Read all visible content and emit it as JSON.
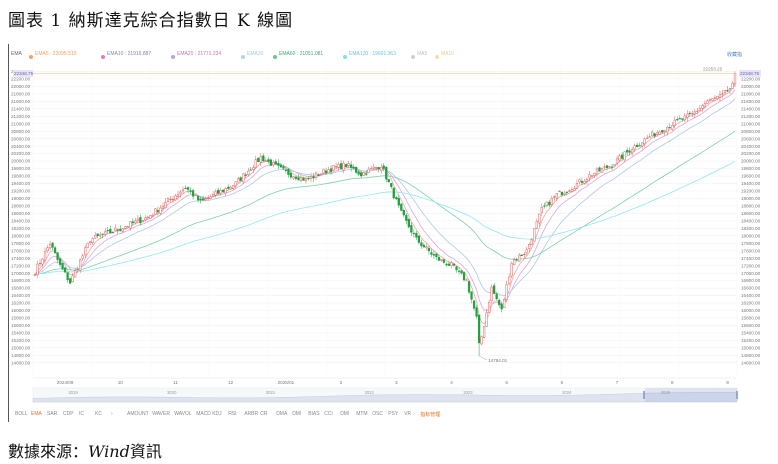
{
  "figure_title": "圖表 1 納斯達克綜合指數日 K 線圖",
  "source_label": "數據來源：",
  "source_name": "Wind",
  "source_suffix": "資訊",
  "toolbar": {
    "type_label": "EMA",
    "legend": [
      {
        "label": "EMA5 : 22095.510",
        "color": "#f0a060"
      },
      {
        "label": "EMA10 : 21916.887",
        "color": "#e080b0"
      },
      {
        "label": "EMA20 : 21771.234",
        "color": "#c0a0e0"
      },
      {
        "label": "EMA30",
        "color": "#a8d8e8"
      },
      {
        "label": "EMA60 : 21051.081",
        "color": "#60c890"
      },
      {
        "label": "EMA120 : 19601.363",
        "color": "#80e0f0"
      },
      {
        "label": "MA5",
        "color": "#d0d0d0"
      },
      {
        "label": "MA10",
        "color": "#f0e0a0"
      }
    ],
    "right_link": "收藏指"
  },
  "indicators": [
    "BOLL",
    "EMA",
    "SAR",
    "CDP",
    "IC",
    "KC",
    "›",
    "AMOUNT",
    "WAVER",
    "WAVOL",
    "MACD",
    "KDJ",
    "RSI",
    "ARBR",
    "CR",
    "DMA",
    "DMI",
    "BIAS",
    "CCI",
    "DMI",
    "MTM",
    "OSC",
    "PSY",
    "VR",
    "指标管理"
  ],
  "chart_data": {
    "type": "candlestick",
    "title": "納斯達克綜合指數日 K 線圖",
    "ylim": [
      14300,
      22600
    ],
    "yticks": [
      14600,
      14800,
      15000,
      15200,
      15400,
      15600,
      15800,
      16000,
      16200,
      16400,
      16600,
      16800,
      17000,
      17200,
      17400,
      17600,
      17800,
      18000,
      18200,
      18400,
      18600,
      18800,
      19000,
      19200,
      19400,
      19600,
      19800,
      20000,
      20200,
      20400,
      20600,
      20800,
      21000,
      21200,
      21400,
      21600,
      21800,
      22000,
      22200,
      22400
    ],
    "ytick_labels": [
      "14600.00",
      "14800.00",
      "15000.00",
      "15200.00",
      "15400.00",
      "15600.00",
      "15800.00",
      "16000.00",
      "16200.00",
      "16400.00",
      "16600.00",
      "16800.00",
      "17000.00",
      "17200.00",
      "17400.00",
      "17600.00",
      "17800.00",
      "18000.00",
      "18200.00",
      "18400.00",
      "18600.00",
      "18800.00",
      "19000.00",
      "19200.00",
      "19400.00",
      "19600.00",
      "19800.00",
      "20000.00",
      "20200.00",
      "20400.00",
      "20600.00",
      "20800.00",
      "21000.00",
      "21200.00",
      "21400.00",
      "21600.00",
      "21800.00",
      "22000.00",
      "22200.00",
      "22400.00"
    ],
    "xlabels": [
      "2024/09",
      "10",
      "11",
      "12",
      "2025/01",
      "2",
      "3",
      "4",
      "5",
      "6",
      "7",
      "8",
      "9"
    ],
    "xlabel_pos": [
      12,
      34,
      56,
      78,
      100,
      122,
      144,
      166,
      188,
      210,
      232,
      254,
      276
    ],
    "n_days": 280,
    "keypoints": [
      [
        0,
        17050
      ],
      [
        6,
        17800
      ],
      [
        10,
        17200
      ],
      [
        14,
        16750
      ],
      [
        22,
        17900
      ],
      [
        34,
        18200
      ],
      [
        45,
        18500
      ],
      [
        60,
        19300
      ],
      [
        66,
        18900
      ],
      [
        80,
        19400
      ],
      [
        90,
        20100
      ],
      [
        100,
        19700
      ],
      [
        108,
        19500
      ],
      [
        118,
        19800
      ],
      [
        124,
        19900
      ],
      [
        130,
        19650
      ],
      [
        138,
        19900
      ],
      [
        146,
        18600
      ],
      [
        152,
        17900
      ],
      [
        160,
        17400
      ],
      [
        166,
        17200
      ],
      [
        172,
        16800
      ],
      [
        178,
        15300
      ],
      [
        182,
        16600
      ],
      [
        186,
        16000
      ],
      [
        190,
        17300
      ],
      [
        196,
        17600
      ],
      [
        202,
        18700
      ],
      [
        208,
        19100
      ],
      [
        214,
        19300
      ],
      [
        222,
        19650
      ],
      [
        230,
        19900
      ],
      [
        238,
        20350
      ],
      [
        246,
        20700
      ],
      [
        254,
        21000
      ],
      [
        262,
        21250
      ],
      [
        268,
        21600
      ],
      [
        274,
        21750
      ],
      [
        280,
        22150
      ]
    ],
    "last_price_label": "22253.25",
    "current_price_label": "22348.75",
    "current_price": 22348.75,
    "low_annotation": "14784.01",
    "low_price": 14784.01,
    "low_index": 177,
    "series": [
      {
        "name": "EMA5",
        "span": 5,
        "color": "#f4a6a6"
      },
      {
        "name": "EMA10",
        "span": 10,
        "color": "#d8a8d8"
      },
      {
        "name": "EMA20",
        "span": 20,
        "color": "#b0c8e8"
      },
      {
        "name": "EMA60",
        "span": 60,
        "color": "#80d0a8"
      },
      {
        "name": "EMA120",
        "span": 120,
        "color": "#90e8f4"
      }
    ],
    "up_color": "#e06060",
    "down_color": "#20a040",
    "navigator_labels": [
      "2019",
      "2020",
      "2021",
      "2022",
      "2023",
      "2024",
      "2025"
    ]
  }
}
